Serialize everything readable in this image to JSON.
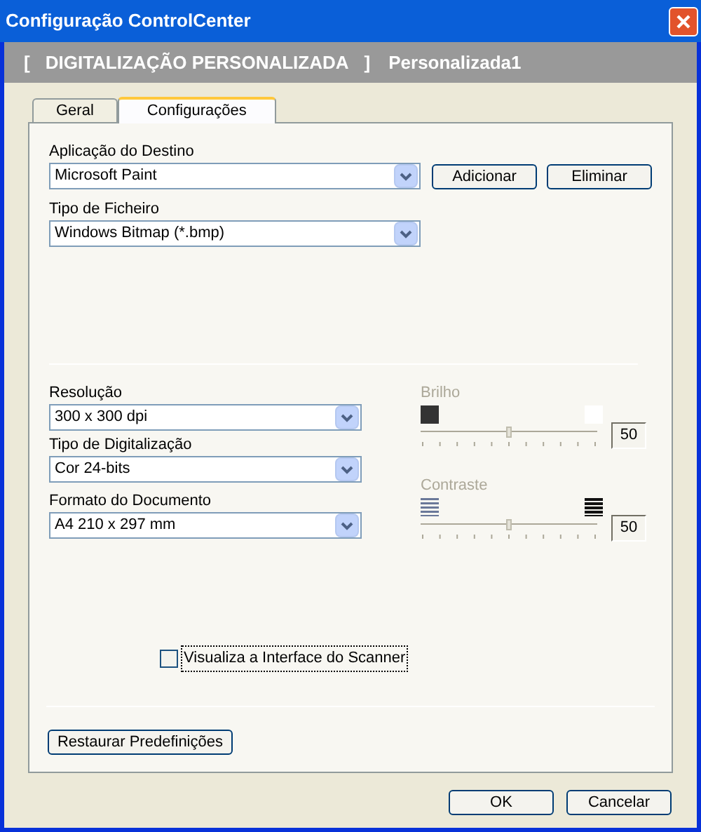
{
  "window": {
    "title": "Configuração ControlCenter"
  },
  "header": {
    "bracket_open": "[",
    "mode": "DIGITALIZAÇÃO PERSONALIZADA",
    "bracket_close": "]",
    "profile": "Personalizada1"
  },
  "tabs": [
    {
      "label": "Geral",
      "selected": false
    },
    {
      "label": "Configurações",
      "selected": true
    }
  ],
  "destination": {
    "label": "Aplicação do Destino",
    "value": "Microsoft Paint",
    "buttons": [
      "Adicionar",
      "Eliminar"
    ]
  },
  "file_type": {
    "label": "Tipo de Ficheiro",
    "value": "Windows Bitmap (*.bmp)"
  },
  "scan_fields": [
    {
      "label": "Resolução",
      "value": "300 x 300 dpi"
    },
    {
      "label": "Tipo de Digitalização",
      "value": "Cor 24-bits"
    },
    {
      "label": "Formato do Documento",
      "value": "A4 210 x 297 mm"
    }
  ],
  "sliders": [
    {
      "kind": "brightness",
      "label": "Brilho",
      "disabled": true,
      "level": 0.5,
      "reading": "50"
    },
    {
      "kind": "contrast",
      "label": "Contraste",
      "disabled": true,
      "level": 0.5,
      "reading": "50"
    }
  ],
  "scanner_interface": {
    "label": "Visualiza a Interface do Scanner",
    "checked": false
  },
  "restore_button": "Restaurar Predefinições",
  "buttons": [
    "OK",
    "Cancelar"
  ]
}
